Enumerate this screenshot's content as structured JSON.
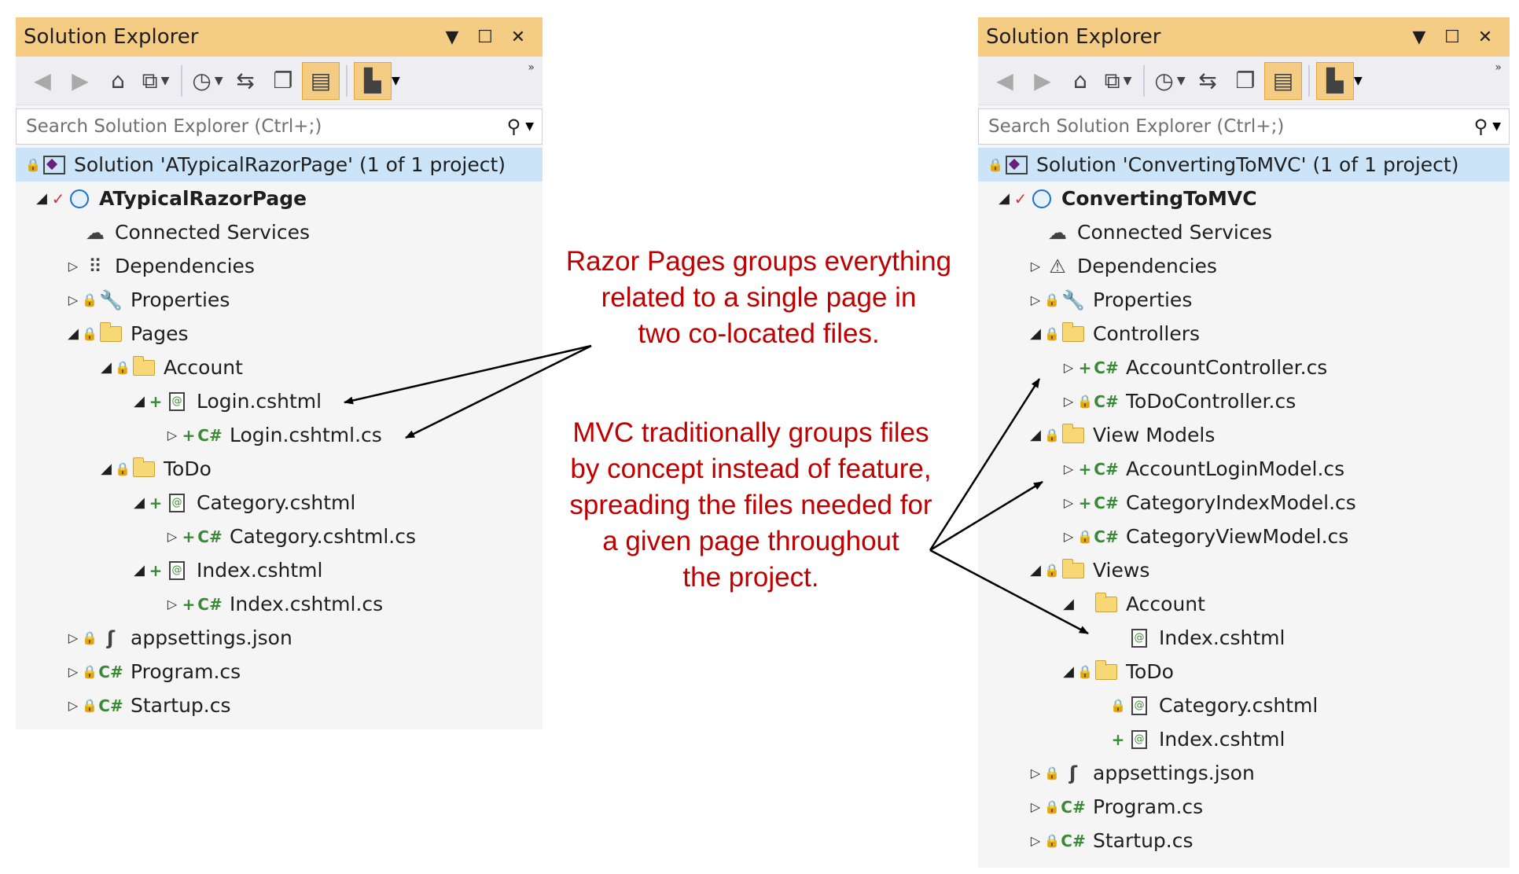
{
  "left": {
    "title": "Solution Explorer",
    "search_placeholder": "Search Solution Explorer (Ctrl+;)",
    "solution": "Solution 'ATypicalRazorPage' (1 of 1 project)",
    "project": "ATypicalRazorPage",
    "items": [
      {
        "label": "Connected Services"
      },
      {
        "label": "Dependencies"
      },
      {
        "label": "Properties"
      },
      {
        "label": "Pages"
      },
      {
        "label": "Account"
      },
      {
        "label": "Login.cshtml"
      },
      {
        "label": "Login.cshtml.cs"
      },
      {
        "label": "ToDo"
      },
      {
        "label": "Category.cshtml"
      },
      {
        "label": "Category.cshtml.cs"
      },
      {
        "label": "Index.cshtml"
      },
      {
        "label": "Index.cshtml.cs"
      },
      {
        "label": "appsettings.json"
      },
      {
        "label": "Program.cs"
      },
      {
        "label": "Startup.cs"
      }
    ]
  },
  "right": {
    "title": "Solution Explorer",
    "search_placeholder": "Search Solution Explorer (Ctrl+;)",
    "solution": "Solution 'ConvertingToMVC' (1 of 1 project)",
    "project": "ConvertingToMVC",
    "items": [
      {
        "label": "Connected Services"
      },
      {
        "label": "Dependencies"
      },
      {
        "label": "Properties"
      },
      {
        "label": "Controllers"
      },
      {
        "label": "AccountController.cs"
      },
      {
        "label": "ToDoController.cs"
      },
      {
        "label": "View Models"
      },
      {
        "label": "AccountLoginModel.cs"
      },
      {
        "label": "CategoryIndexModel.cs"
      },
      {
        "label": "CategoryViewModel.cs"
      },
      {
        "label": "Views"
      },
      {
        "label": "Account"
      },
      {
        "label": "Index.cshtml"
      },
      {
        "label": "ToDo"
      },
      {
        "label": "Category.cshtml"
      },
      {
        "label": "Index.cshtml"
      },
      {
        "label": "appsettings.json"
      },
      {
        "label": "Program.cs"
      },
      {
        "label": "Startup.cs"
      }
    ]
  },
  "annotations": {
    "razor": [
      "Razor Pages groups everything",
      "related to a single page in",
      "two co-located files."
    ],
    "mvc": [
      "MVC traditionally groups files",
      "by concept instead of feature,",
      "spreading the files needed for",
      "a given page throughout",
      "the project."
    ]
  },
  "colors": {
    "title_bar": "#f5cc84",
    "selection": "#cce4f7",
    "annotation": "#c00000"
  }
}
